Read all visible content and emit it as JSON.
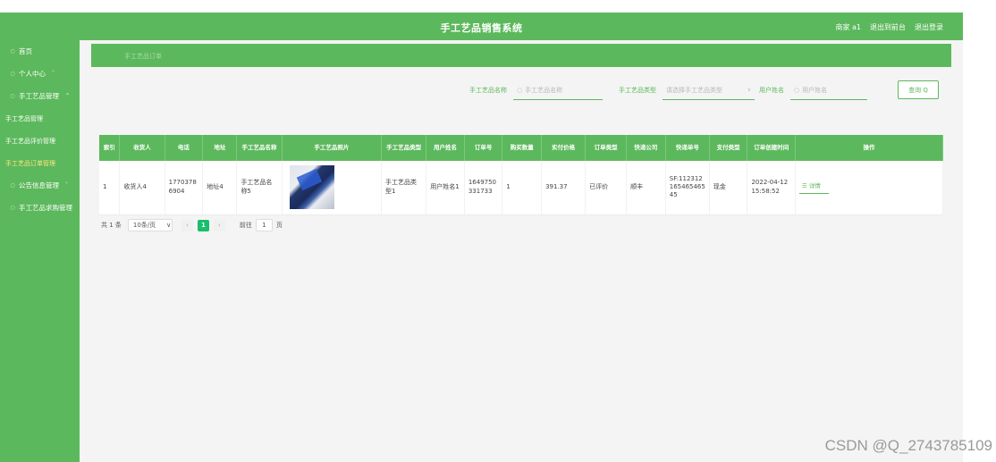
{
  "header": {
    "title": "手工艺品销售系统",
    "user_label": "商家 a1",
    "back_label": "退出到前台",
    "logout_label": "退出登录"
  },
  "sidebar": {
    "items": [
      {
        "label": "首页"
      },
      {
        "label": "个人中心",
        "chevron": "ˇ"
      },
      {
        "label": "手工艺品管理",
        "chevron": "^"
      }
    ],
    "sub_items": [
      {
        "label": "手工艺品管理"
      },
      {
        "label": "手工艺品评价管理"
      },
      {
        "label": "手工艺品订单管理"
      }
    ],
    "items_after": [
      {
        "label": "公告信息管理",
        "chevron": "ˇ"
      },
      {
        "label": "手工艺品求购管理"
      }
    ]
  },
  "breadcrumb": {
    "text": "手工艺品订单"
  },
  "search": {
    "name_label": "手工艺品名称",
    "name_placeholder": "手工艺品名称",
    "type_label": "手工艺品类型",
    "type_placeholder": "请选择手工艺品类型",
    "user_label": "用户姓名",
    "user_placeholder": "用户姓名",
    "query_label": "查询 Q"
  },
  "table": {
    "columns": [
      "索引",
      "收货人",
      "电话",
      "地址",
      "手工艺品名称",
      "手工艺品照片",
      "手工艺品类型",
      "用户姓名",
      "订单号",
      "购买数量",
      "实付价格",
      "订单类型",
      "快递公司",
      "快递单号",
      "支付类型",
      "订单创建时间",
      "操作"
    ],
    "rows": [
      {
        "index": "1",
        "receiver": "收货人4",
        "phone": "17703786904",
        "address": "地址4",
        "product_name": "手工艺品名称5",
        "product_type": "手工艺品类型1",
        "user_name": "用户姓名1",
        "order_no": "1649750331733",
        "quantity": "1",
        "price": "391.37",
        "order_type": "已评价",
        "courier": "顺丰",
        "tracking_no": "SF:112312165465465 45",
        "pay_type": "现金",
        "created_at": "2022-04-12 15:58:52",
        "action": "详情"
      }
    ]
  },
  "pagination": {
    "total_label": "共 1 条",
    "page_size_label": "10条/页",
    "current_page": "1",
    "goto_label": "前往",
    "goto_value": "1",
    "page_word": "页"
  },
  "watermark": "CSDN @Q_2743785109",
  "colors": {
    "primary": "#5cb85c",
    "active_sub": "#ffe680",
    "page_active": "#19be6b"
  }
}
